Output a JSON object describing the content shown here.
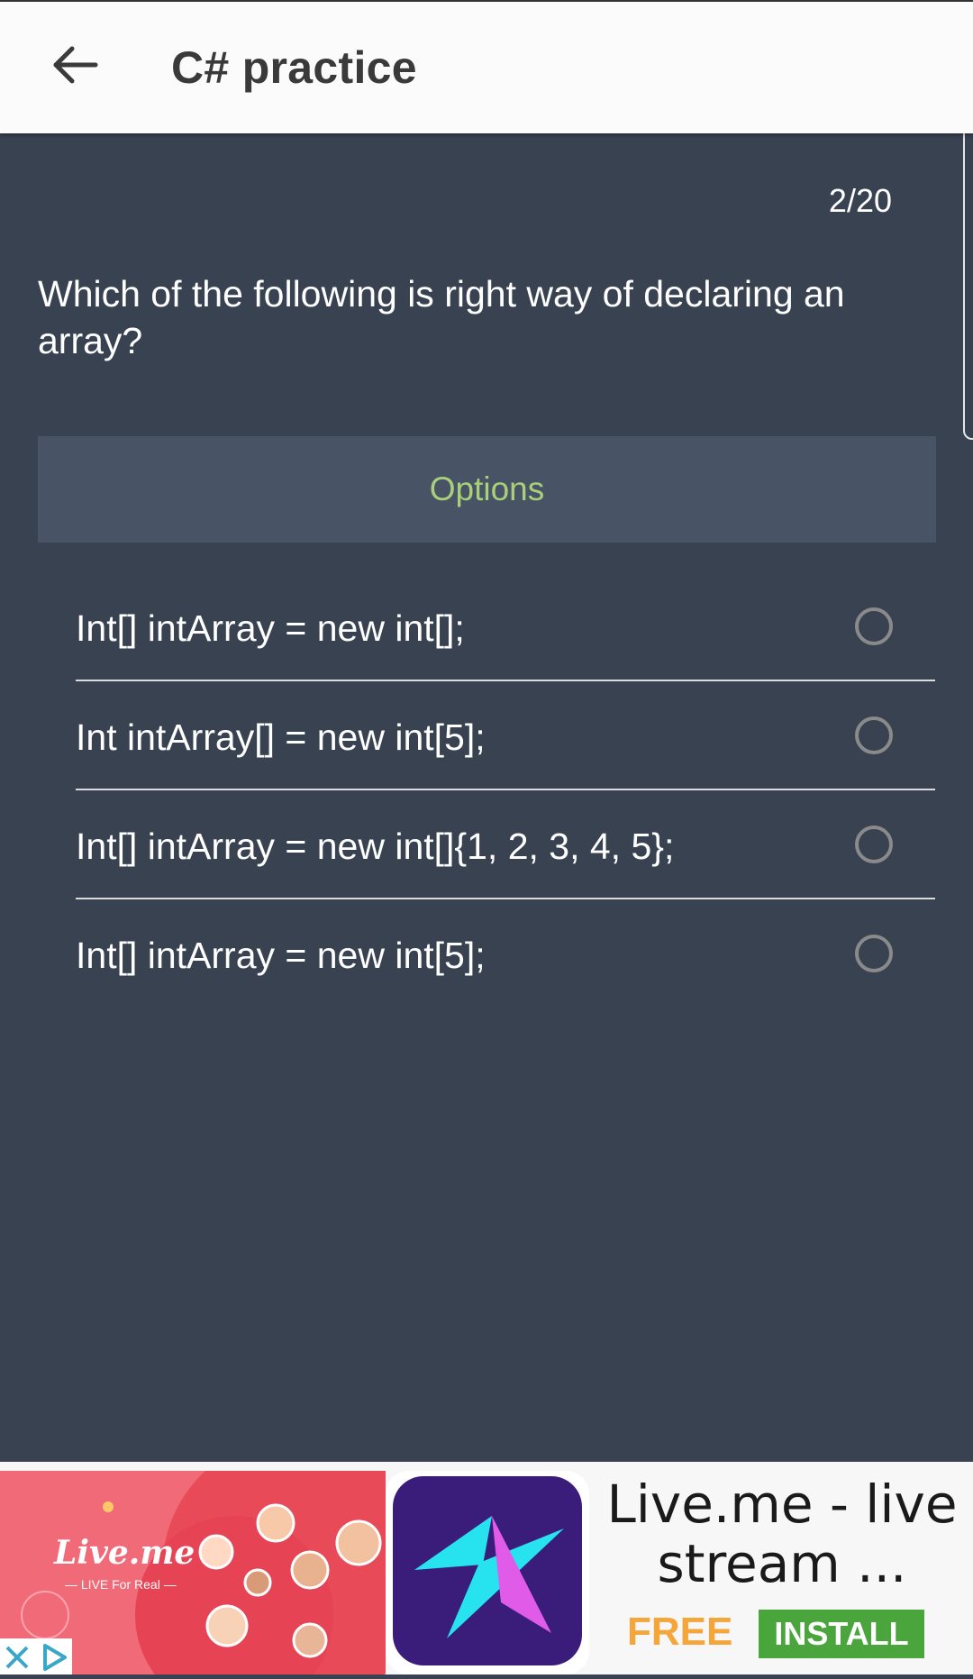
{
  "app_bar": {
    "title": "C# practice",
    "back_icon": "arrow-left-icon"
  },
  "quiz": {
    "counter": "2/20",
    "question": "Which of the following is right way of declaring an array?",
    "options_header": "Options",
    "options": [
      {
        "label": "Int[] intArray = new int[];",
        "selected": false
      },
      {
        "label": "Int intArray[] = new int[5];",
        "selected": false
      },
      {
        "label": "Int[] intArray = new int[]{1, 2, 3, 4, 5};",
        "selected": false
      },
      {
        "label": "Int[] intArray = new int[5];",
        "selected": false
      }
    ]
  },
  "ad": {
    "brand": "Live.me",
    "slogan": "— LIVE For Real —",
    "title": "Live.me - live stream ...",
    "price": "FREE",
    "install_label": "INSTALL",
    "close_icon": "close-icon",
    "adchoices_icon": "adchoices-icon"
  },
  "colors": {
    "app_bar_bg": "#fbfbfb",
    "page_bg": "#384251",
    "options_header_bg": "#485466",
    "options_header_text": "#a9cf7a",
    "install_button": "#4aa53c",
    "free_text": "#f4a63a"
  }
}
